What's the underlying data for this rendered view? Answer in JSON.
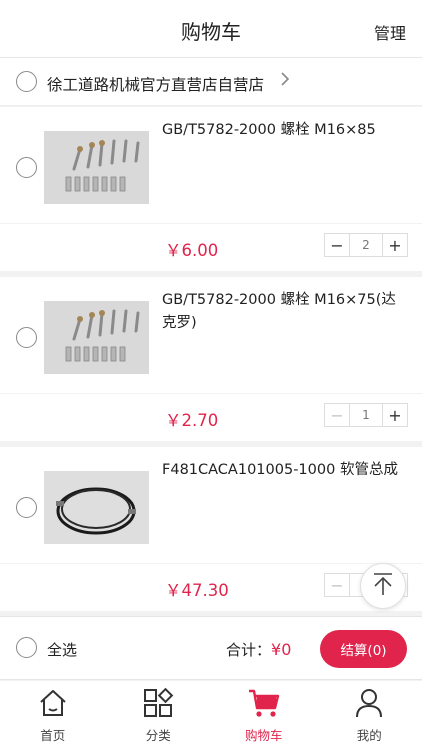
{
  "header": {
    "title": "购物车",
    "manage_label": "管理"
  },
  "store": {
    "name": "徐工道路机械官方直营店自营店",
    "chevron_icon": "chevron-right-icon"
  },
  "items": [
    {
      "name": "GB/T5782-2000 螺栓 M16×85",
      "price": "￥6.00",
      "quantity": "2",
      "image": "bolts-photo"
    },
    {
      "name": "GB/T5782-2000 螺栓 M16×75(达克罗)",
      "price": "￥2.70",
      "quantity": "1",
      "image": "bolts-photo"
    },
    {
      "name": "F481CACA101005-1000 软管总成",
      "price": "￥47.30",
      "quantity": "1",
      "image": "hose-photo"
    }
  ],
  "stepper": {
    "minus": "−",
    "plus": "+"
  },
  "checkout": {
    "select_all_label": "全选",
    "total_label": "合计：",
    "total_value": "¥0",
    "settle_label": "结算(0)"
  },
  "tabs": [
    {
      "label": "首页",
      "icon": "home-icon"
    },
    {
      "label": "分类",
      "icon": "category-icon"
    },
    {
      "label": "购物车",
      "icon": "cart-icon",
      "active": true
    },
    {
      "label": "我的",
      "icon": "user-icon"
    }
  ],
  "colors": {
    "accent": "#e0244c",
    "background": "#f2f2f2"
  }
}
